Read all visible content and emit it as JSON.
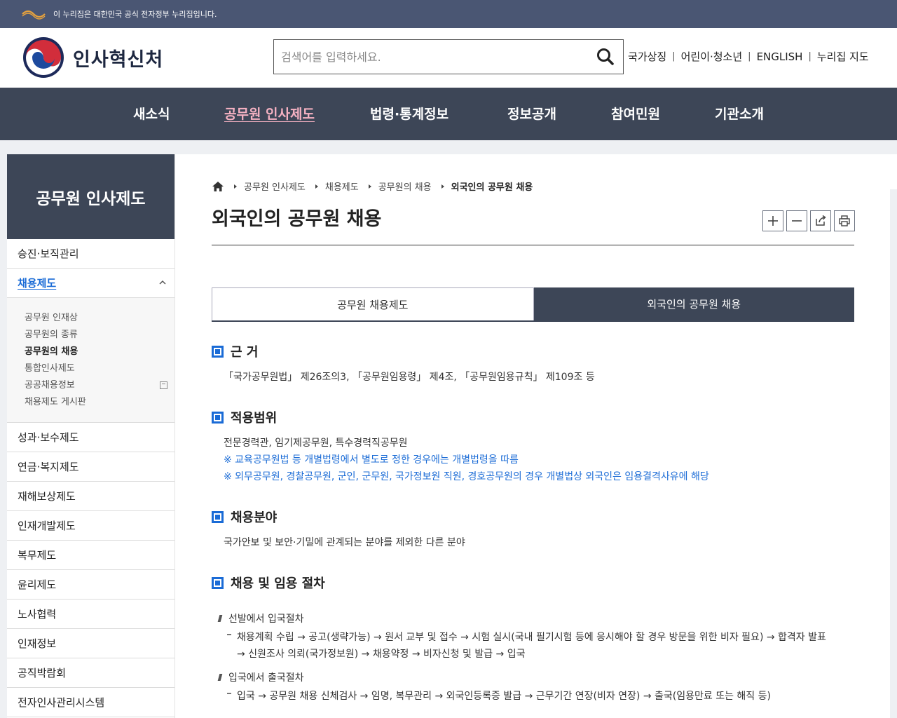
{
  "gov_banner": {
    "text": "이 누리집은 대한민국 공식 전자정부 누리집입니다."
  },
  "header": {
    "agency_name": "인사혁신처",
    "search_placeholder": "검색어를 입력하세요.",
    "util_links": [
      "국가상징",
      "어린이·청소년",
      "ENGLISH",
      "누리집 지도"
    ]
  },
  "gnb": {
    "items": [
      "새소식",
      "공무원 인사제도",
      "법령·통계정보",
      "정보공개",
      "참여민원",
      "기관소개"
    ],
    "active_index": 1
  },
  "sidebar": {
    "title": "공무원 인사제도",
    "items_before": [
      "승진·보직관리"
    ],
    "open_item": "채용제도",
    "sub_items": [
      "공무원 인재상",
      "공무원의 종류",
      "공무원의 채용",
      "통합인사제도",
      "공공채용정보",
      "채용제도 게시판"
    ],
    "sub_current_index": 2,
    "items_after": [
      "성과·보수제도",
      "연금·복지제도",
      "재해보상제도",
      "인재개발제도",
      "복무제도",
      "윤리제도",
      "노사협력",
      "인재정보",
      "공직박람회",
      "전자인사관리시스템"
    ]
  },
  "breadcrumb": [
    "공무원 인사제도",
    "채용제도",
    "공무원의 채용",
    "외국인의 공무원 채용"
  ],
  "page_title": "외국인의 공무원 채용",
  "tabs": [
    "공무원 채용제도",
    "외국인의 공무원 채용"
  ],
  "sections": {
    "basis": {
      "heading": "근 거",
      "text": "「국가공무원법」 제26조의3, 「공무원임용령」 제4조, 「공무원임용규칙」 제109조 등"
    },
    "scope": {
      "heading": "적용범위",
      "text": "전문경력관, 임기제공무원, 특수경력직공무원",
      "notes": [
        "※ 교육공무원법 등 개별법령에서 별도로 정한 경우에는 개별법령을 따름",
        "※ 외무공무원, 경찰공무원, 군인, 군무원, 국가정보원 직원, 경호공무원의 경우 개별법상 외국인은 임용결격사유에 해당"
      ]
    },
    "field": {
      "heading": "채용분야",
      "text": "국가안보 및 보안·기밀에 관계되는 분야를 제외한 다른 분야"
    },
    "procedure": {
      "heading": "채용 및 임용 절차",
      "steps": [
        {
          "title": "선발에서 입국절차",
          "line1": "채용계획 수립 → 공고(생략가능) → 원서 교부 및 접수 → 시험 실시(국내 필기시험 등에 응시해야 할 경우 방문을 위한 비자 필요) → 합격자 발표",
          "line2": "→ 신원조사 의뢰(국가정보원) → 채용약정 → 비자신청 및 발급 → 입국"
        },
        {
          "title": "입국에서 출국절차",
          "line1": "입국 → 공무원 채용 신체검사 → 임명, 복무관리 → 외국인등록증 발급 → 근무기간 연장(비자 연장) → 출국(임용만료 또는 해직 등)"
        }
      ]
    }
  },
  "colors": {
    "nav_bg": "#3d4657",
    "gov_bar": "#4a5673",
    "accent_blue": "#1a6bd6",
    "active_pink": "#f6b2c3"
  }
}
